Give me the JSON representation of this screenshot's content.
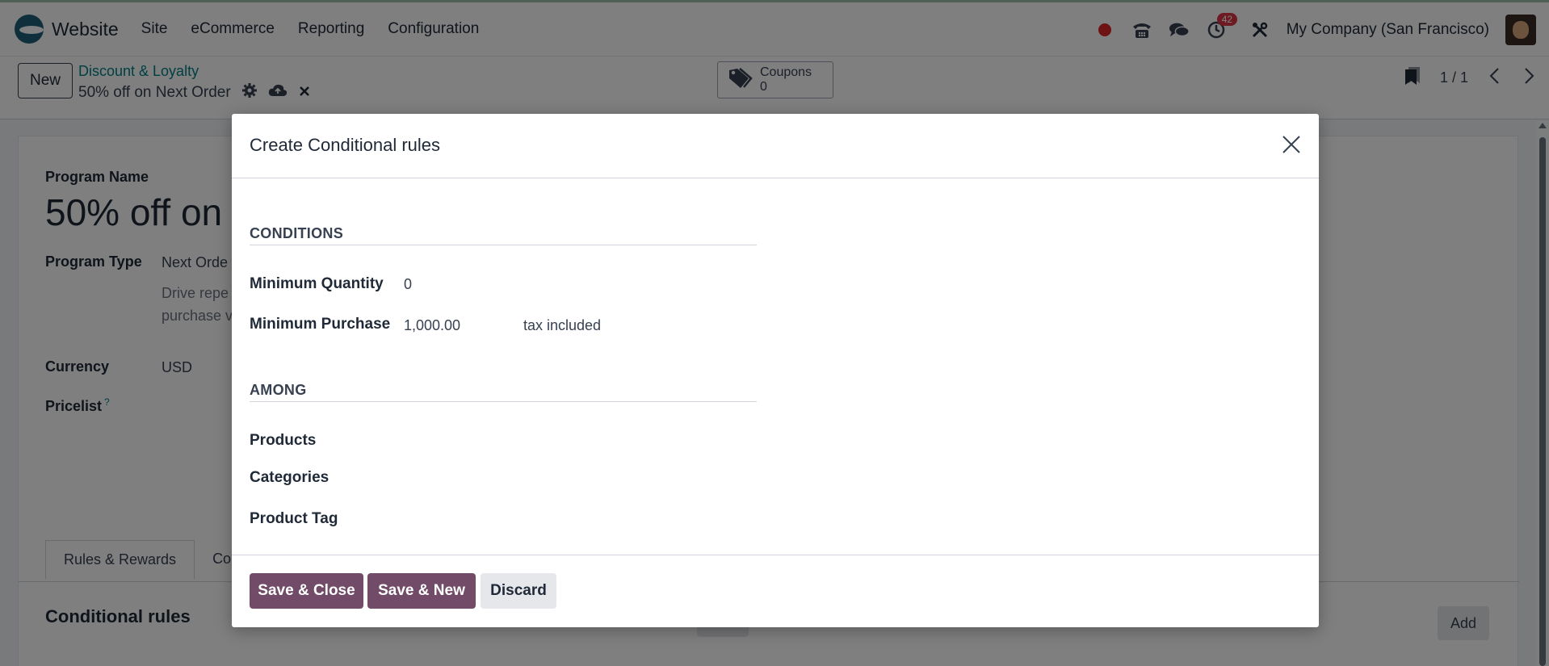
{
  "navbar": {
    "app_name": "Website",
    "menu": [
      "Site",
      "eCommerce",
      "Reporting",
      "Configuration"
    ],
    "activity_badge": "42",
    "company": "My Company (San Francisco)"
  },
  "control": {
    "new_label": "New",
    "breadcrumb_parent": "Discount & Loyalty",
    "breadcrumb_current": "50% off on Next Order",
    "coupons_label": "Coupons",
    "coupons_count": "0",
    "pager": "1 / 1"
  },
  "form": {
    "program_name_label": "Program Name",
    "program_name_value": "50% off on",
    "program_type_label": "Program Type",
    "program_type_value": "Next Orde",
    "program_type_desc_1": "Drive repe",
    "program_type_desc_2": "purchase v",
    "currency_label": "Currency",
    "currency_value": "USD",
    "pricelist_label": "Pricelist",
    "pricelist_help": "?",
    "tabs": [
      "Rules & Rewards",
      "Co"
    ],
    "conditional_rules_title": "Conditional rules",
    "add_label": "Add"
  },
  "modal": {
    "title": "Create Conditional rules",
    "conditions_heading": "CONDITIONS",
    "min_qty_label": "Minimum Quantity",
    "min_qty_value": "0",
    "min_purchase_label": "Minimum Purchase",
    "min_purchase_value": "1,000.00",
    "tax_mode": "tax included",
    "among_heading": "AMONG",
    "products_label": "Products",
    "categories_label": "Categories",
    "product_tag_label": "Product Tag",
    "save_close_label": "Save & Close",
    "save_new_label": "Save & New",
    "discard_label": "Discard"
  },
  "colors": {
    "primary": "#714b67",
    "link": "#017e84",
    "badge": "#dc3545",
    "recording": "#dc2626"
  }
}
